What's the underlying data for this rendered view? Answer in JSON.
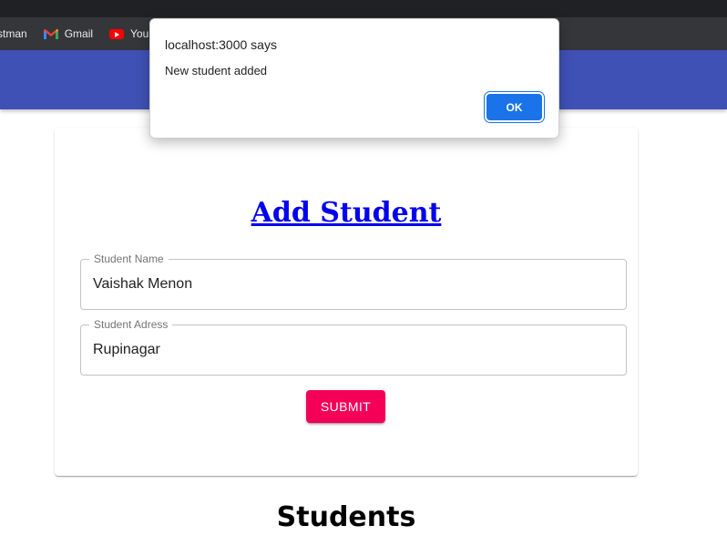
{
  "browser": {
    "bookmarks": [
      {
        "label": "stman",
        "icon": "none"
      },
      {
        "label": "Gmail",
        "icon": "gmail-icon"
      },
      {
        "label": "You",
        "icon": "youtube-icon"
      }
    ]
  },
  "form": {
    "title": "Add Student",
    "name_label": "Student Name",
    "name_value": "Vaishak Menon",
    "address_label": "Student Adress",
    "address_value": "Rupinagar",
    "submit_label": "SUBMIT"
  },
  "students_heading": "Students",
  "alert": {
    "title": "localhost:3000 says",
    "message": "New student added",
    "ok_label": "OK"
  },
  "colors": {
    "appbar": "#3f51b5",
    "submit": "#f50057",
    "link": "#0000ee",
    "ok_button": "#1a73e8"
  }
}
